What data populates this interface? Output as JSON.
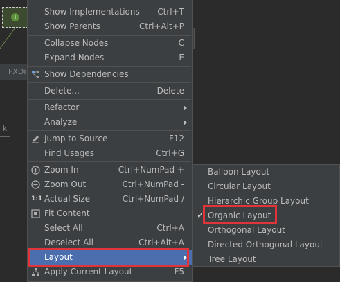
{
  "background": {
    "tab_text": "FXDi",
    "k_text": "k",
    "node_icon": "I"
  },
  "main_menu": {
    "items": [
      {
        "label": "Show Implementations",
        "shortcut": "Ctrl+T"
      },
      {
        "label": "Show Parents",
        "shortcut": "Ctrl+Alt+P"
      },
      {
        "label": "Collapse Nodes",
        "shortcut": "C"
      },
      {
        "label": "Expand Nodes",
        "shortcut": "E"
      },
      {
        "label": "Show Dependencies",
        "shortcut": "",
        "icon": "dependencies-icon"
      },
      {
        "label": "Delete...",
        "shortcut": "Delete"
      },
      {
        "label": "Refactor",
        "shortcut": "",
        "submenu": true
      },
      {
        "label": "Analyze",
        "shortcut": "",
        "submenu": true
      },
      {
        "label": "Jump to Source",
        "shortcut": "F12",
        "icon": "edit-pencil-icon"
      },
      {
        "label": "Find Usages",
        "shortcut": "Ctrl+G"
      },
      {
        "label": "Zoom In",
        "shortcut": "Ctrl+NumPad +",
        "icon": "zoom-in-icon"
      },
      {
        "label": "Zoom Out",
        "shortcut": "Ctrl+NumPad -",
        "icon": "zoom-out-icon"
      },
      {
        "label": "Actual Size",
        "shortcut": "Ctrl+NumPad /",
        "icon": "actual-size-icon",
        "icon_text": "1:1"
      },
      {
        "label": "Fit Content",
        "shortcut": "",
        "icon": "fit-content-icon"
      },
      {
        "label": "Select All",
        "shortcut": "Ctrl+A"
      },
      {
        "label": "Deselect All",
        "shortcut": "Ctrl+Alt+A"
      },
      {
        "label": "Layout",
        "shortcut": "",
        "submenu": true,
        "selected": true
      },
      {
        "label": "Apply Current Layout",
        "shortcut": "F5",
        "icon": "apply-layout-icon"
      }
    ]
  },
  "layout_submenu": {
    "check_mark": "✓",
    "items": [
      {
        "label": "Balloon Layout"
      },
      {
        "label": "Circular Layout"
      },
      {
        "label": "Hierarchic Group Layout"
      },
      {
        "label": "Organic Layout",
        "checked": true
      },
      {
        "label": "Orthogonal Layout"
      },
      {
        "label": "Directed Orthogonal Layout"
      },
      {
        "label": "Tree Layout"
      }
    ]
  },
  "colors": {
    "menu_bg": "#3c3f41",
    "selection": "#4b6eaf",
    "highlight_box": "#e0343a",
    "text": "#bbbbbb"
  }
}
